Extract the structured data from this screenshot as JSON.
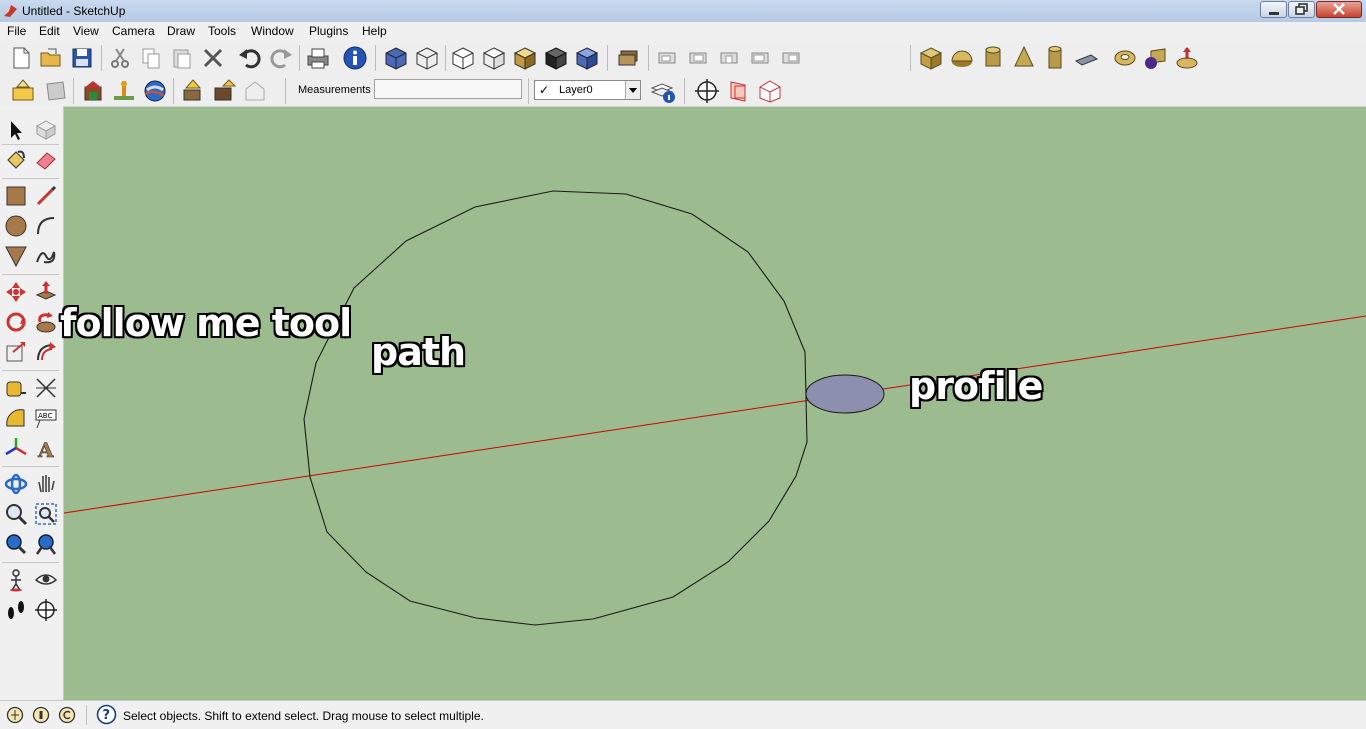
{
  "window": {
    "title": "Untitled - SketchUp"
  },
  "menu": {
    "items": [
      "File",
      "Edit",
      "View",
      "Camera",
      "Draw",
      "Tools",
      "Window",
      "Plugins",
      "Help"
    ]
  },
  "toolbar": {
    "measurements_label": "Measurements",
    "measurements_value": "",
    "layer_value": "Layer0",
    "layer_checked": "✓"
  },
  "annotations": {
    "follow_me": "follow me tool",
    "path": "path",
    "profile": "profile"
  },
  "status": {
    "text": "Select objects. Shift to extend select. Drag mouse to select multiple."
  },
  "colors": {
    "viewport_bg": "#9cbc8f",
    "axis_red": "#cc0000",
    "profile_fill": "#8d8fae"
  }
}
